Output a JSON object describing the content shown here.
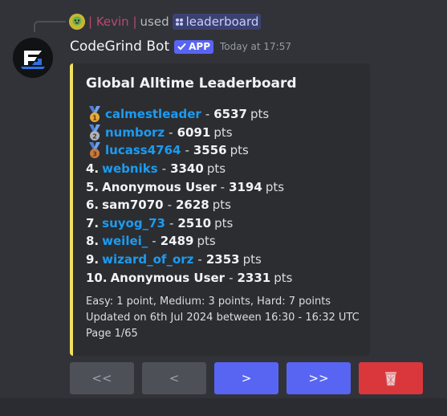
{
  "command": {
    "user": "| Kevin |",
    "used_label": "used",
    "command_name": "leaderboard"
  },
  "bot": {
    "name": "CodeGrind Bot",
    "badge": "APP",
    "timestamp": "Today at 17:57"
  },
  "embed": {
    "accent_color": "#f0e05c",
    "title": "Global Alltime Leaderboard",
    "entries": [
      {
        "medal": "gold",
        "rank": "",
        "username": "calmestleader",
        "linked": true,
        "score": "6537",
        "unit": "pts"
      },
      {
        "medal": "silver",
        "rank": "",
        "username": "numborz",
        "linked": true,
        "score": "6091",
        "unit": "pts"
      },
      {
        "medal": "bronze",
        "rank": "",
        "username": "lucass4764",
        "linked": true,
        "score": "3556",
        "unit": "pts"
      },
      {
        "medal": "",
        "rank": "4.",
        "username": "webniks",
        "linked": true,
        "score": "3340",
        "unit": "pts"
      },
      {
        "medal": "",
        "rank": "5.",
        "username": "Anonymous User",
        "linked": false,
        "score": "3194",
        "unit": "pts"
      },
      {
        "medal": "",
        "rank": "6.",
        "username": "sam7070",
        "linked": false,
        "score": "2628",
        "unit": "pts"
      },
      {
        "medal": "",
        "rank": "7.",
        "username": "suyog_73",
        "linked": true,
        "score": "2510",
        "unit": "pts"
      },
      {
        "medal": "",
        "rank": "8.",
        "username": "weilei_",
        "linked": true,
        "score": "2489",
        "unit": "pts"
      },
      {
        "medal": "",
        "rank": "9.",
        "username": "wizard_of_orz",
        "linked": true,
        "score": "2353",
        "unit": "pts"
      },
      {
        "medal": "",
        "rank": "10.",
        "username": "Anonymous User",
        "linked": false,
        "score": "2331",
        "unit": "pts"
      }
    ],
    "footer_lines": [
      "Easy: 1 point, Medium: 3 points, Hard: 7 points",
      "Updated on 6th Jul 2024 between 16:30 - 16:32 UTC",
      "Page 1/65"
    ]
  },
  "buttons": [
    {
      "label": "<<",
      "style": "grey",
      "name": "first-page-button"
    },
    {
      "label": "<",
      "style": "grey",
      "name": "previous-page-button"
    },
    {
      "label": ">",
      "style": "blurple",
      "name": "next-page-button"
    },
    {
      "label": ">>",
      "style": "blurple",
      "name": "last-page-button"
    },
    {
      "label": "",
      "style": "red",
      "name": "delete-button",
      "icon": "wastebasket-icon"
    }
  ]
}
